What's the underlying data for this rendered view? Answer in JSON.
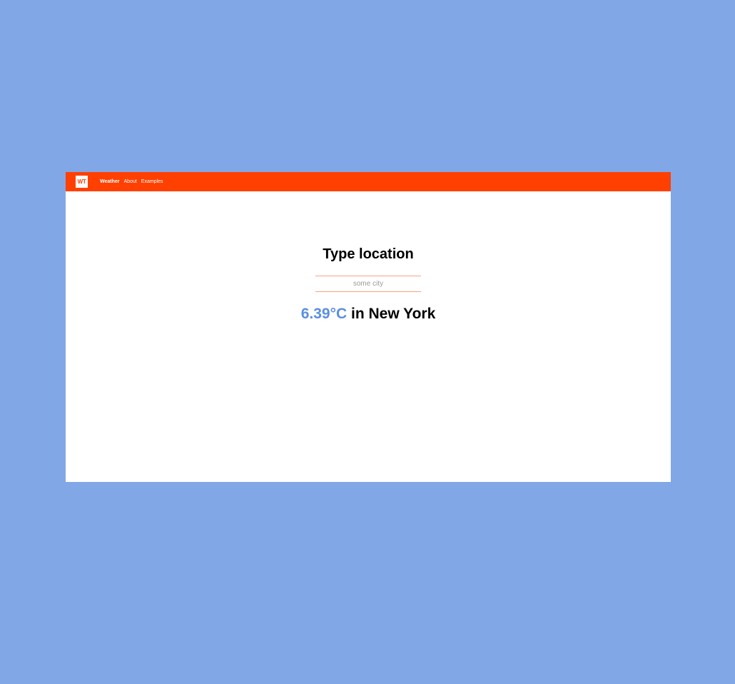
{
  "colors": {
    "background": "#82a7e6",
    "navbar": "#ff4000",
    "temperature": "#5b8fe0",
    "input_border": "#f4a47f"
  },
  "navbar": {
    "logo_text": "WT",
    "links": [
      {
        "label": "Weather",
        "active": true
      },
      {
        "label": "About",
        "active": false
      },
      {
        "label": "Examples",
        "active": false
      }
    ]
  },
  "main": {
    "title": "Type location",
    "search": {
      "placeholder": "some city",
      "value": ""
    },
    "result": {
      "temperature": "6.39°C",
      "location_text": "in New York"
    }
  }
}
